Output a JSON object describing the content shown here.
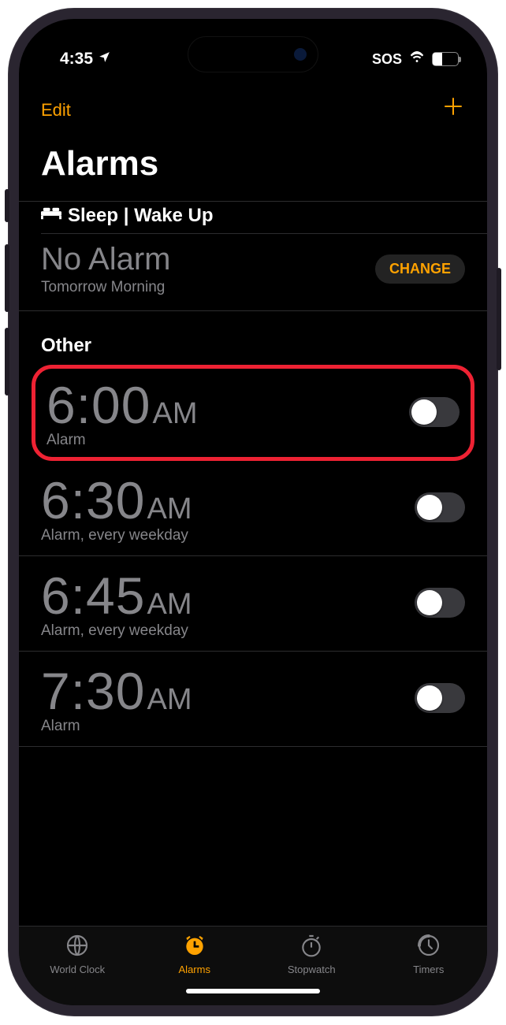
{
  "status": {
    "time": "4:35",
    "sos": "SOS",
    "battery_pct": "36"
  },
  "nav": {
    "edit": "Edit",
    "title": "Alarms"
  },
  "sleep_section": {
    "header": "Sleep | Wake Up",
    "main": "No Alarm",
    "sub": "Tomorrow Morning",
    "change": "CHANGE"
  },
  "other_section": {
    "header": "Other"
  },
  "alarms": [
    {
      "time": "6:00",
      "ampm": "AM",
      "label": "Alarm",
      "highlight": true,
      "on": false
    },
    {
      "time": "6:30",
      "ampm": "AM",
      "label": "Alarm, every weekday",
      "highlight": false,
      "on": false
    },
    {
      "time": "6:45",
      "ampm": "AM",
      "label": "Alarm, every weekday",
      "highlight": false,
      "on": false
    },
    {
      "time": "7:30",
      "ampm": "AM",
      "label": "Alarm",
      "highlight": false,
      "on": false
    }
  ],
  "tabs": [
    {
      "id": "world-clock",
      "label": "World Clock",
      "active": false
    },
    {
      "id": "alarms",
      "label": "Alarms",
      "active": true
    },
    {
      "id": "stopwatch",
      "label": "Stopwatch",
      "active": false
    },
    {
      "id": "timers",
      "label": "Timers",
      "active": false
    }
  ],
  "colors": {
    "accent": "#ffa200",
    "highlight_border": "#ee2233"
  }
}
